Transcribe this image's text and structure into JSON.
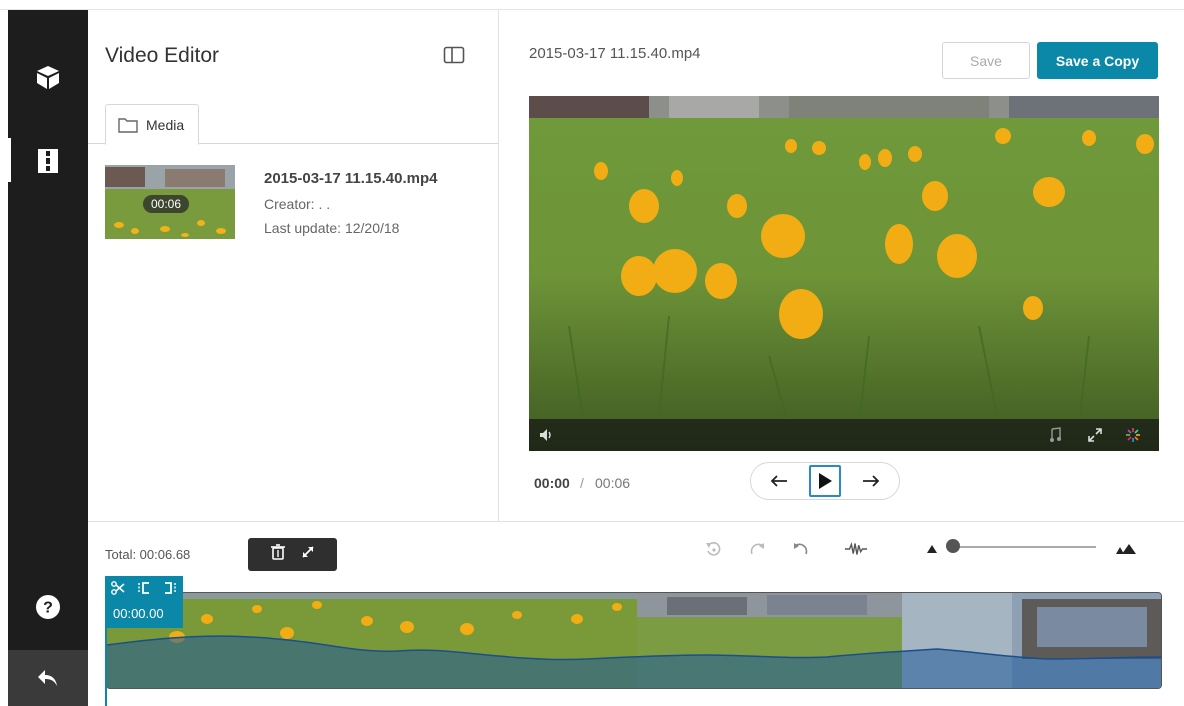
{
  "app": {
    "title": "Video Editor"
  },
  "sidebar": {
    "items": [
      {
        "icon": "cube-icon"
      },
      {
        "icon": "film-strip-icon"
      },
      {
        "icon": "help-icon"
      },
      {
        "icon": "back-arrow-icon"
      }
    ]
  },
  "media_panel": {
    "tab_label": "Media",
    "item": {
      "title": "2015-03-17 11.15.40.mp4",
      "creator": "Creator: . .",
      "last_update": "Last update: 12/20/18",
      "duration_badge": "00:06"
    }
  },
  "player": {
    "file_name": "2015-03-17 11.15.40.mp4",
    "save_label": "Save",
    "save_copy_label": "Save a Copy",
    "current_time": "00:00",
    "separator": "/",
    "duration": "00:06"
  },
  "timeline": {
    "total": "Total: 00:06.68",
    "playhead_time": "00:00.00"
  },
  "colors": {
    "accent": "#0b87a8",
    "sidebar": "#1d1d1d"
  }
}
